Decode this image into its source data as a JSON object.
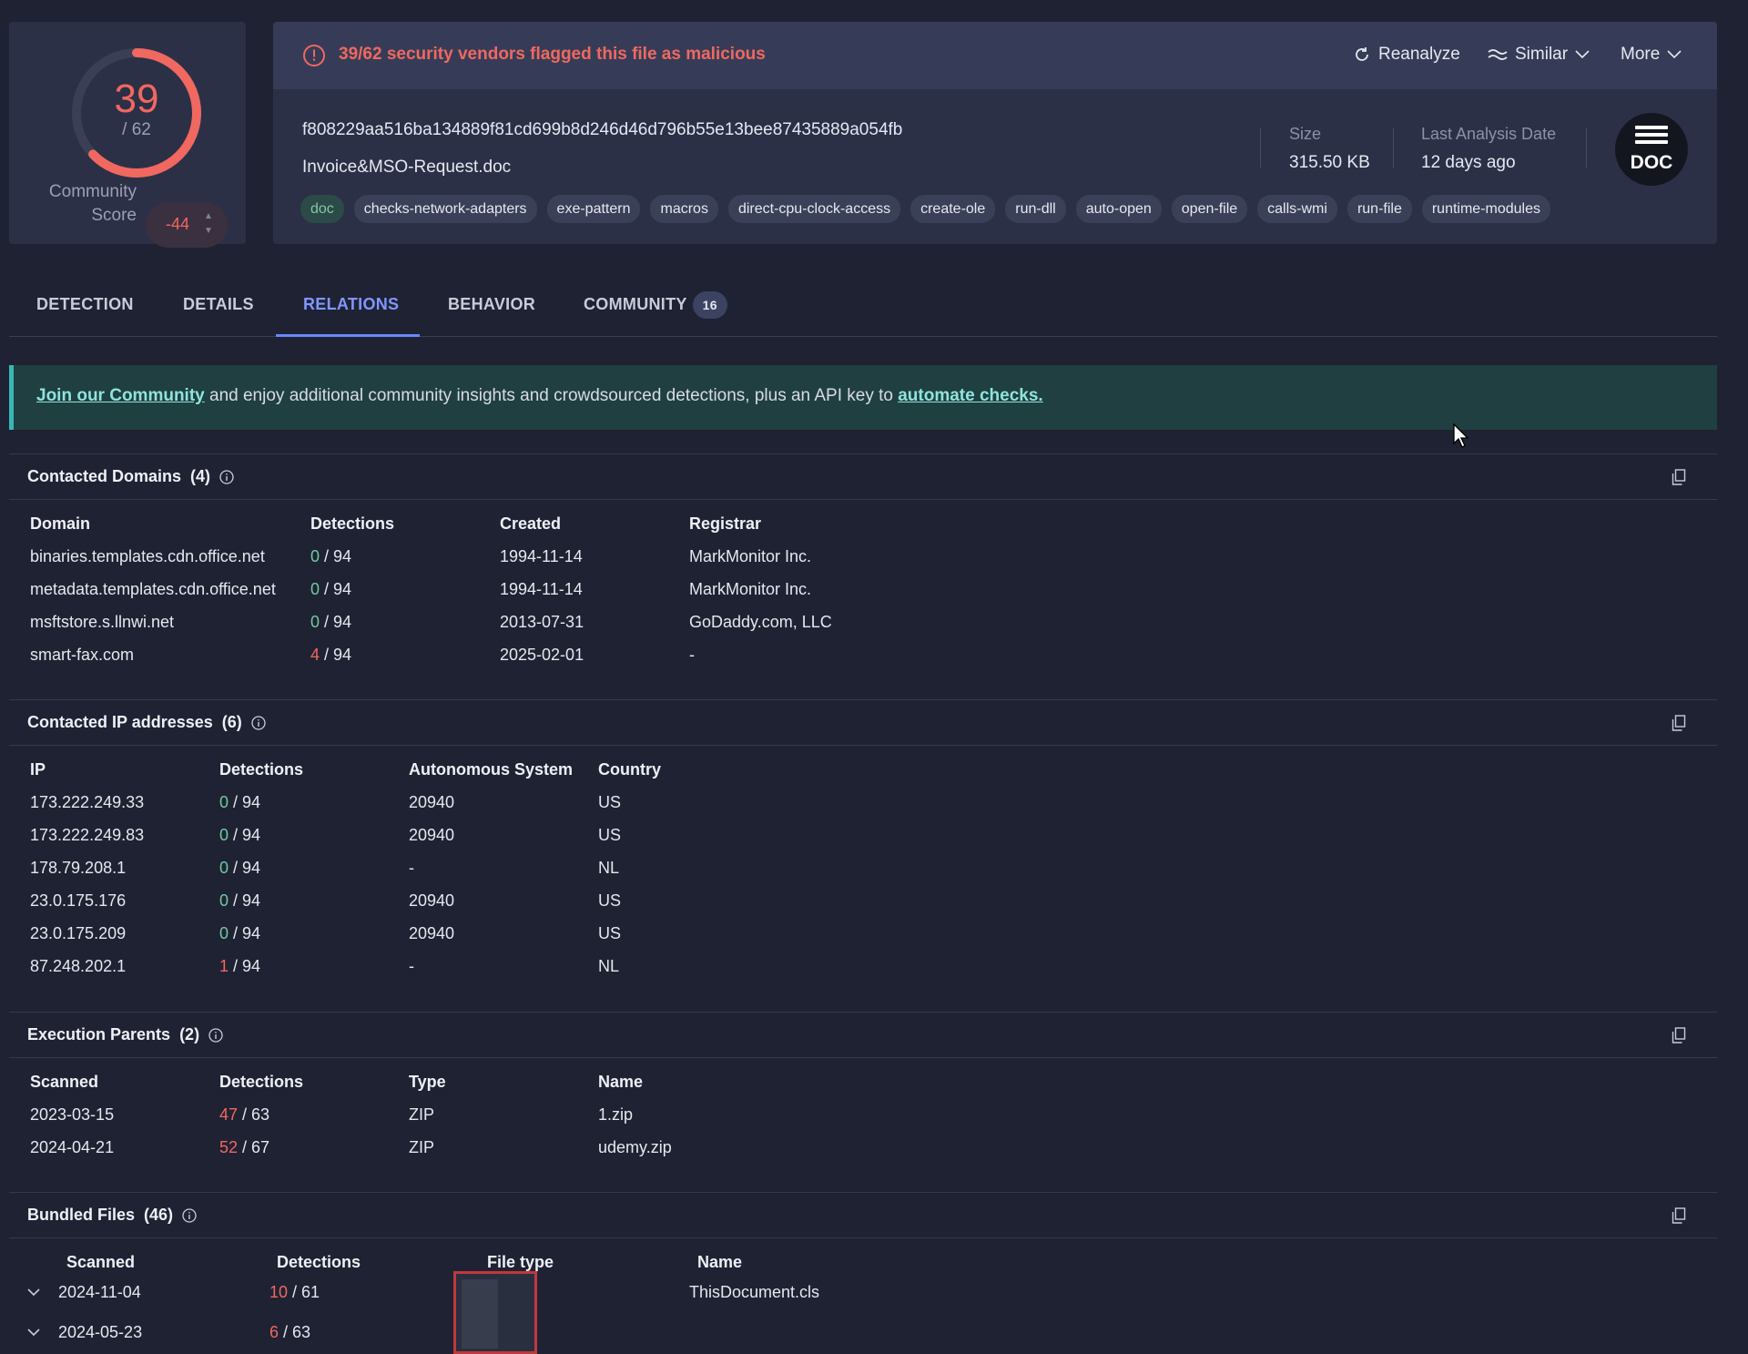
{
  "score": {
    "detections": "39",
    "total": "/ 62",
    "ratio": 0.629,
    "community_label_1": "Community",
    "community_label_2": "Score",
    "community_value": "-44"
  },
  "file": {
    "alert": "39/62 security vendors flagged this file as malicious",
    "actions": {
      "reanalyze": "Reanalyze",
      "similar": "Similar",
      "more": "More"
    },
    "hash": "f808229aa516ba134889f81cd699b8d246d46d796b55e13bee87435889a054fb",
    "name": "Invoice&MSO-Request.doc",
    "tags": [
      "doc",
      "checks-network-adapters",
      "exe-pattern",
      "macros",
      "direct-cpu-clock-access",
      "create-ole",
      "run-dll",
      "auto-open",
      "open-file",
      "calls-wmi",
      "run-file",
      "runtime-modules"
    ],
    "size_label": "Size",
    "size_value": "315.50 KB",
    "date_label": "Last Analysis Date",
    "date_value": "12 days ago",
    "type_icon_text": "DOC"
  },
  "tabs": [
    {
      "label": "DETECTION"
    },
    {
      "label": "DETAILS"
    },
    {
      "label": "RELATIONS"
    },
    {
      "label": "BEHAVIOR"
    },
    {
      "label": "COMMUNITY",
      "badge": "16"
    }
  ],
  "banner": {
    "link1": "Join our Community",
    "middle": " and enjoy additional community insights and crowdsourced detections, plus an API key to ",
    "link2": "automate checks."
  },
  "domains": {
    "title": "Contacted Domains",
    "count": "(4)",
    "headers": [
      "Domain",
      "Detections",
      "Created",
      "Registrar"
    ],
    "rows": [
      [
        "binaries.templates.cdn.office.net",
        "0",
        "/ 94",
        "1994-11-14",
        "MarkMonitor Inc."
      ],
      [
        "metadata.templates.cdn.office.net",
        "0",
        "/ 94",
        "1994-11-14",
        "MarkMonitor Inc."
      ],
      [
        "msftstore.s.llnwi.net",
        "0",
        "/ 94",
        "2013-07-31",
        "GoDaddy.com, LLC"
      ],
      [
        "smart-fax.com",
        "4",
        "/ 94",
        "2025-02-01",
        "-"
      ]
    ]
  },
  "ips": {
    "title": "Contacted IP addresses",
    "count": "(6)",
    "headers": [
      "IP",
      "Detections",
      "Autonomous System",
      "Country"
    ],
    "rows": [
      [
        "173.222.249.33",
        "0",
        "/ 94",
        "20940",
        "US"
      ],
      [
        "173.222.249.83",
        "0",
        "/ 94",
        "20940",
        "US"
      ],
      [
        "178.79.208.1",
        "0",
        "/ 94",
        "-",
        "NL"
      ],
      [
        "23.0.175.176",
        "0",
        "/ 94",
        "20940",
        "US"
      ],
      [
        "23.0.175.209",
        "0",
        "/ 94",
        "20940",
        "US"
      ],
      [
        "87.248.202.1",
        "1",
        "/ 94",
        "-",
        "NL"
      ]
    ]
  },
  "parents": {
    "title": "Execution Parents",
    "count": "(2)",
    "headers": [
      "Scanned",
      "Detections",
      "Type",
      "Name"
    ],
    "rows": [
      [
        "2023-03-15",
        "47",
        "/ 63",
        "ZIP",
        "1.zip"
      ],
      [
        "2024-04-21",
        "52",
        "/ 67",
        "ZIP",
        "udemy.zip"
      ]
    ]
  },
  "bundled": {
    "title": "Bundled Files",
    "count": "(46)",
    "headers": [
      "Scanned",
      "Detections",
      "File type",
      "Name"
    ],
    "rows": [
      [
        "2024-11-04",
        "10",
        "/ 61",
        "ThisDocument.cls"
      ],
      [
        "2024-05-23",
        "6",
        "/ 63",
        ""
      ]
    ]
  },
  "colors": {
    "malicious": "#f0685f",
    "clean": "#6fc9a0",
    "accent": "#6a86ff",
    "background": "#1f2233"
  }
}
